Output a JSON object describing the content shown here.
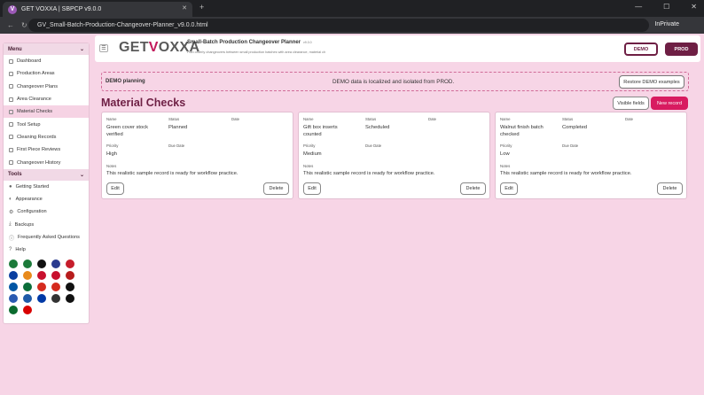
{
  "browser": {
    "tab_title": "GET VOXXA | SBPCP v9.0.0",
    "tab_icon": "V",
    "url": "GV_Small-Batch-Production-Changeover-Planner_v9.0.0.html",
    "inprivate": "InPrivate"
  },
  "header": {
    "logo_a": "GET",
    "logo_b": "V",
    "logo_c": "OXXA",
    "app_title": "Small-Batch Production Changeover Planner",
    "version": "v9.0.0",
    "app_subtitle": "Plan orderly changeovers between small production batches with area clearance, material ch",
    "demo_btn": "DEMO",
    "prod_btn": "PROD",
    "collapse_icon": "☰"
  },
  "sidebar": {
    "menu_label": "Menu",
    "tools_label": "Tools",
    "menu_items": [
      "Dashboard",
      "Production Areas",
      "Changeover Plans",
      "Area Clearance",
      "Material Checks",
      "Tool Setup",
      "Cleaning Records",
      "First Piece Reviews",
      "Changeover History"
    ],
    "tool_items": [
      "Getting Started",
      "Appearance",
      "Configuration",
      "Backups",
      "Frequently Asked Questions",
      "Help"
    ],
    "flag_colors": [
      "#1b7a3a",
      "#1b7a3a",
      "#111111",
      "#2a3b8f",
      "#c61d2b",
      "#0a3fa0",
      "#e88a1b",
      "#c8102e",
      "#c8102e",
      "#b71c1c",
      "#0055a4",
      "#0b6e3a",
      "#d52b1e",
      "#d52b1e",
      "#111111",
      "#2a5ab0",
      "#1e5aa8",
      "#0039a6",
      "#333333",
      "#111111",
      "#0b6b2e",
      "#d80000"
    ]
  },
  "notice": {
    "label": "DEMO planning",
    "text": "DEMO data is localized and isolated from PROD.",
    "restore_btn": "Restore DEMO examples"
  },
  "page": {
    "title": "Material Checks",
    "visible_fields_btn": "Visible fields",
    "new_record_btn": "New record"
  },
  "cards": [
    {
      "name_label": "Name",
      "name": "Green cover stock verified",
      "status_label": "Status",
      "status": "Planned",
      "date_label": "Date",
      "priority_label": "Priority",
      "priority": "High",
      "due_label": "Due Date",
      "notes_label": "Notes",
      "notes": "This realistic sample record is ready for workflow practice.",
      "edit": "Edit",
      "delete": "Delete"
    },
    {
      "name_label": "Name",
      "name": "Gift box inserts counted",
      "status_label": "Status",
      "status": "Scheduled",
      "date_label": "Date",
      "priority_label": "Priority",
      "priority": "Medium",
      "due_label": "Due Date",
      "notes_label": "Notes",
      "notes": "This realistic sample record is ready for workflow practice.",
      "edit": "Edit",
      "delete": "Delete"
    },
    {
      "name_label": "Name",
      "name": "Walnut finish batch checked",
      "status_label": "Status",
      "status": "Completed",
      "date_label": "Date",
      "priority_label": "Priority",
      "priority": "Low",
      "due_label": "Due Date",
      "notes_label": "Notes",
      "notes": "This realistic sample record is ready for workflow practice.",
      "edit": "Edit",
      "delete": "Delete"
    }
  ]
}
